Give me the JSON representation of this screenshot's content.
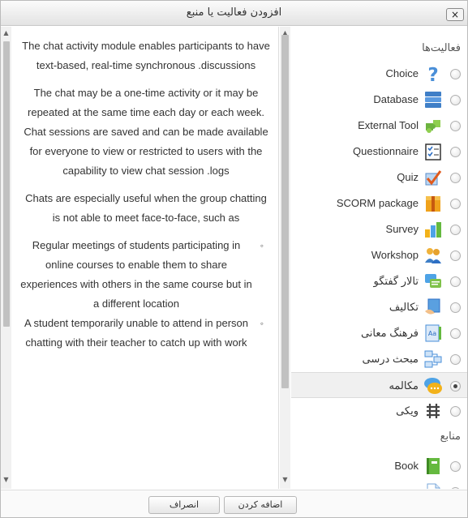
{
  "dialog": {
    "title": "افزودن فعالیت یا منبع",
    "close_label": "×"
  },
  "description": {
    "paragraphs": [
      "The chat activity module enables participants to have text-based, real-time synchronous .discussions",
      "The chat may be a one-time activity or it may be repeated at the same time each day or each week. Chat sessions are saved and can be made available for everyone to view or restricted to users with the capability to view chat session .logs",
      "Chats are especially useful when the group chatting is not able to meet face-to-face, such as"
    ],
    "bullets": [
      "Regular meetings of students participating in online courses to enable them to share experiences with others in the same course but in a different location",
      "A student temporarily unable to attend in person chatting with their teacher to catch up with work"
    ]
  },
  "options": {
    "activities_heading": "فعالیت‌ها",
    "activities": [
      {
        "label": "Choice",
        "icon": "question-icon",
        "selected": false
      },
      {
        "label": "Database",
        "icon": "database-icon",
        "selected": false
      },
      {
        "label": "External Tool",
        "icon": "puzzle-icon",
        "selected": false
      },
      {
        "label": "Questionnaire",
        "icon": "checklist-icon",
        "selected": false
      },
      {
        "label": "Quiz",
        "icon": "quiz-check-icon",
        "selected": false
      },
      {
        "label": "SCORM package",
        "icon": "package-icon",
        "selected": false
      },
      {
        "label": "Survey",
        "icon": "bar-chart-icon",
        "selected": false
      },
      {
        "label": "Workshop",
        "icon": "people-icon",
        "selected": false
      },
      {
        "label": "تالار گفتگو",
        "icon": "forum-icon",
        "selected": false
      },
      {
        "label": "تکالیف",
        "icon": "assignment-icon",
        "selected": false
      },
      {
        "label": "فرهنگ معانی",
        "icon": "glossary-icon",
        "selected": false
      },
      {
        "label": "مبحث درسی",
        "icon": "lesson-icon",
        "selected": false
      },
      {
        "label": "مکالمه",
        "icon": "chat-icon",
        "selected": true
      },
      {
        "label": "ویکی",
        "icon": "wiki-icon",
        "selected": false
      }
    ],
    "resources_heading": "منابع",
    "resources": [
      {
        "label": "Book",
        "icon": "book-icon",
        "selected": false
      },
      {
        "label": "",
        "icon": "file-icon",
        "selected": false
      }
    ]
  },
  "footer": {
    "add_label": "اضافه کردن",
    "cancel_label": "انصراف"
  },
  "colors": {
    "selected_row": "#f0f0f0",
    "text": "#333333"
  }
}
